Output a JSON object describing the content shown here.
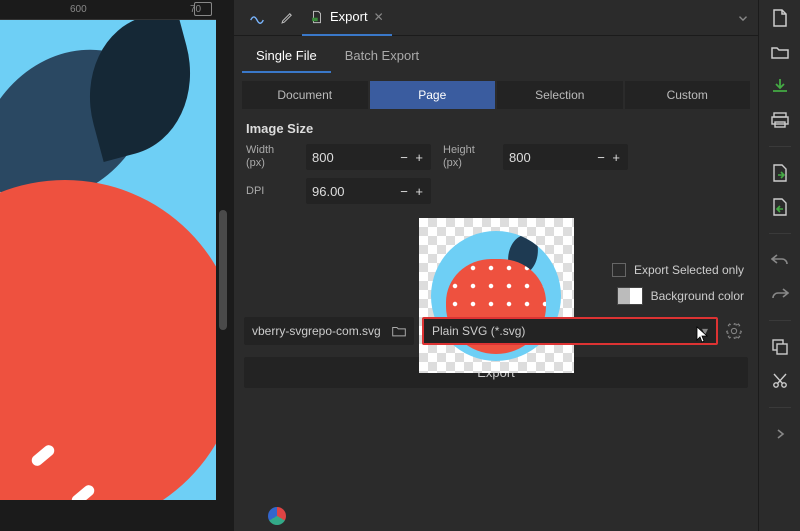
{
  "ruler": {
    "minor": "70",
    "major": "600"
  },
  "panelTabs": {
    "exportLabel": "Export"
  },
  "modeTabs": {
    "single": "Single File",
    "batch": "Batch Export"
  },
  "whatTabs": {
    "document": "Document",
    "page": "Page",
    "selection": "Selection",
    "custom": "Custom"
  },
  "imageSize": {
    "title": "Image Size",
    "widthLabel": "Width (px)",
    "widthVal": "800",
    "heightLabel": "Height (px)",
    "heightVal": "800",
    "dpiLabel": "DPI",
    "dpiVal": "96.00"
  },
  "options": {
    "exportSelectedOnly": "Export Selected only",
    "backgroundColor": "Background color"
  },
  "fileRow": {
    "filename": "vberry-svgrepo-com.svg",
    "formatSelected": "Plain SVG (*.svg)"
  },
  "exportBtn": "Export"
}
